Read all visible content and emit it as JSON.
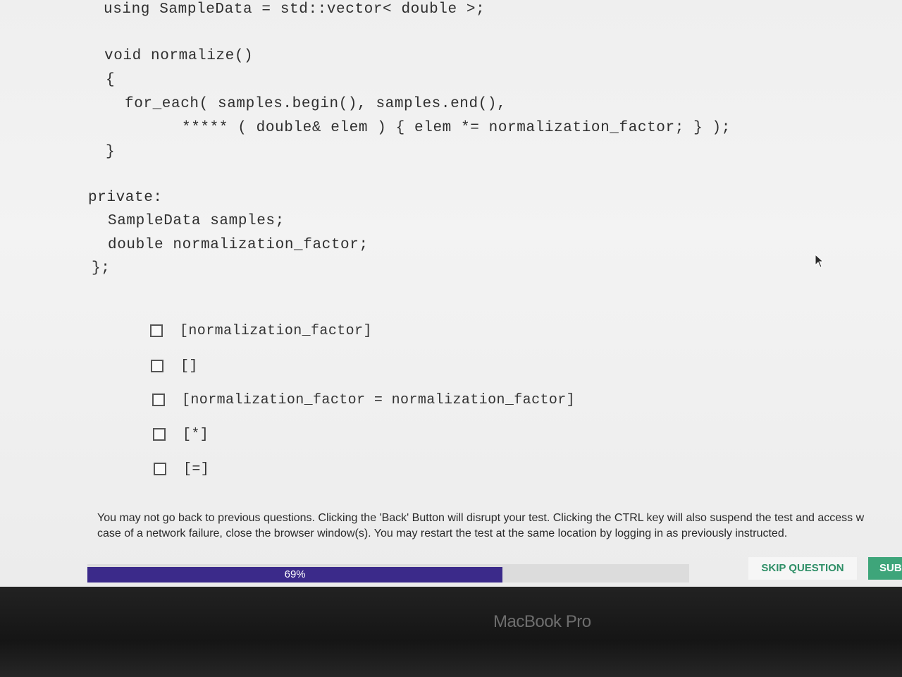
{
  "code": {
    "lines": [
      "using SampleData = std::vector< double >;",
      "void normalize()",
      "{",
      "for_each( samples.begin(), samples.end(),",
      "***** ( double& elem ) { elem *= normalization_factor; } );",
      "}",
      "private:",
      "SampleData samples;",
      "double normalization_factor;",
      "};"
    ]
  },
  "options": [
    {
      "label": "[normalization_factor]",
      "checked": false
    },
    {
      "label": "[]",
      "checked": false
    },
    {
      "label": "[normalization_factor = normalization_factor]",
      "checked": false
    },
    {
      "label": "[*]",
      "checked": false
    },
    {
      "label": "[=]",
      "checked": false
    }
  ],
  "notice": {
    "line1": "You may not go back to previous questions. Clicking the 'Back' Button will disrupt your test. Clicking the CTRL key will also suspend the test and access w",
    "line2": "case of a network failure, close the browser window(s). You may restart the test at the same location by logging in as previously instructed."
  },
  "progress": {
    "label": "69%",
    "fraction": 0.69,
    "fill_color": "#3b2a8a"
  },
  "buttons": {
    "skip_label": "SKIP QUESTION",
    "submit_label": "SUB"
  },
  "device": {
    "brand": "MacBook Pro"
  },
  "colors": {
    "accent_green": "#2f8f67",
    "submit_bg": "#3ea57a"
  },
  "icons": {
    "cursor": "mouse-pointer-icon"
  }
}
